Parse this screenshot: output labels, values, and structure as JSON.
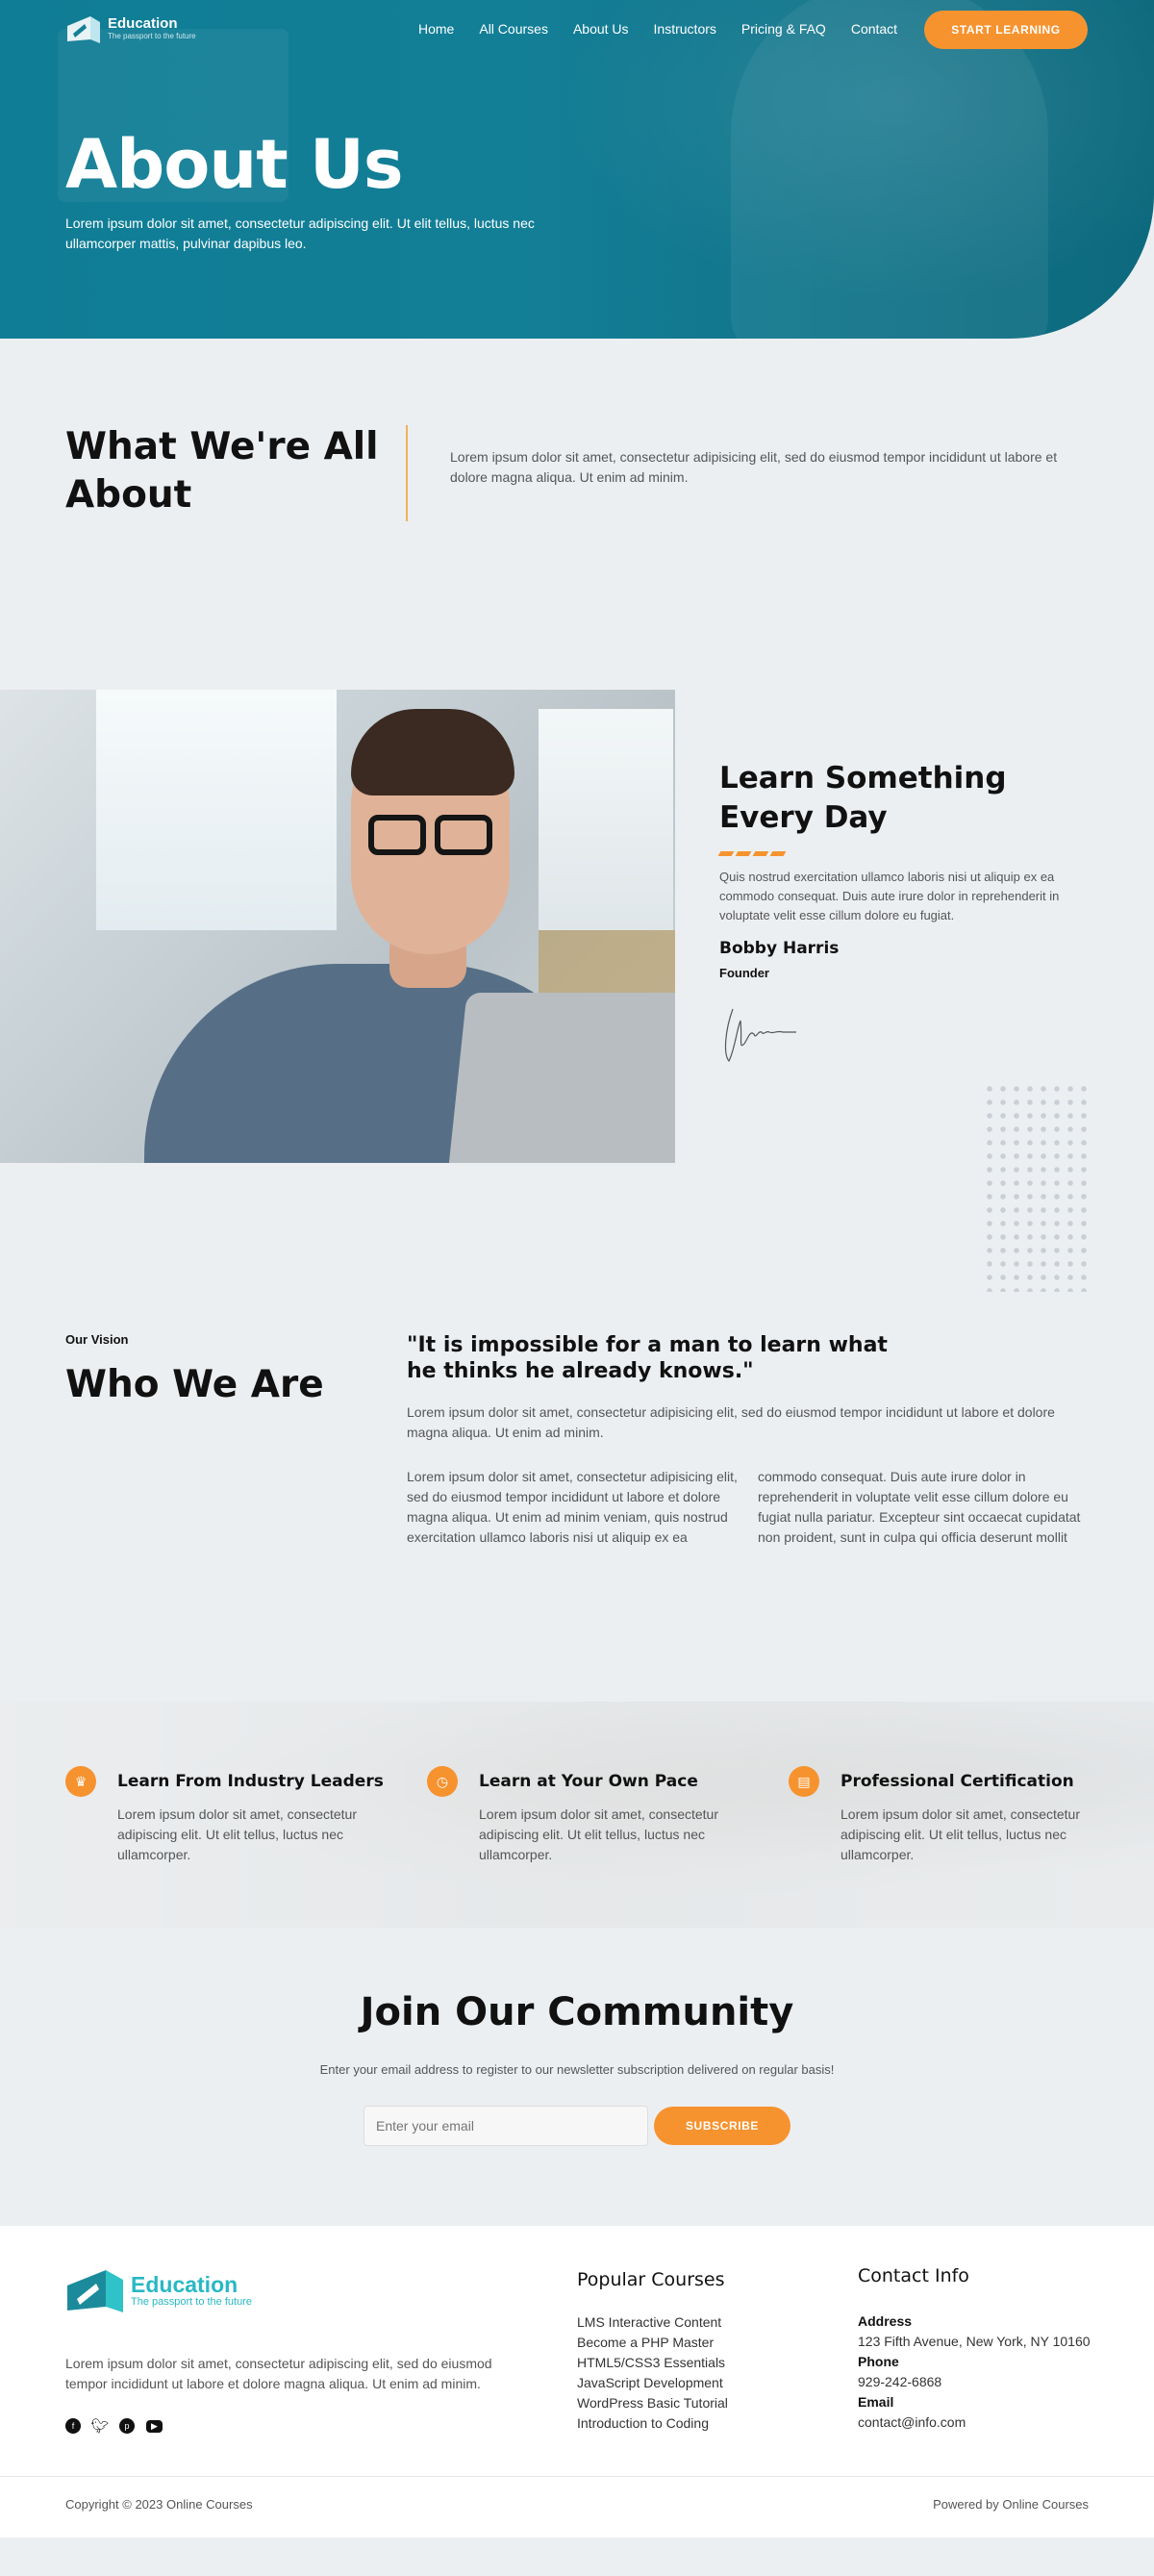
{
  "brand": {
    "name": "Education",
    "tagline": "The passport to the future",
    "accent": "#f6932f",
    "primary": "#127f97"
  },
  "nav": {
    "links": [
      "Home",
      "All Courses",
      "About Us",
      "Instructors",
      "Pricing & FAQ",
      "Contact"
    ],
    "cta": "START LEARNING"
  },
  "hero": {
    "title": "About Us",
    "description": "Lorem ipsum dolor sit amet, consectetur adipiscing elit. Ut elit tellus, luctus nec ullamcorper mattis, pulvinar dapibus leo."
  },
  "about": {
    "title": "What We're All About",
    "text": "Lorem ipsum dolor sit amet, consectetur adipisicing elit, sed do eiusmod tempor incididunt ut labore et dolore magna aliqua. Ut enim ad minim."
  },
  "founder": {
    "title": "Learn Something Every Day",
    "text": "Quis nostrud exercitation ullamco laboris nisi ut aliquip ex ea commodo consequat. Duis aute irure dolor in reprehenderit in voluptate velit esse cillum dolore eu fugiat.",
    "name": "Bobby Harris",
    "role": "Founder"
  },
  "vision": {
    "kicker": "Our Vision",
    "title": "Who We Are",
    "quote": "\"It is impossible for a man to learn what he thinks he already knows.\"",
    "lead": "Lorem ipsum dolor sit amet, consectetur adipisicing elit, sed do eiusmod tempor incididunt ut labore et dolore magna aliqua. Ut enim ad minim.",
    "body": "Lorem ipsum dolor sit amet, consectetur adipisicing elit, sed do eiusmod tempor incididunt ut labore et dolore magna aliqua. Ut enim ad minim veniam, quis nostrud exercitation ullamco laboris nisi ut aliquip ex ea commodo consequat. Duis aute irure dolor in reprehenderit in voluptate velit esse cillum dolore eu fugiat nulla pariatur. Excepteur sint occaecat cupidatat non proident, sunt in culpa qui officia deserunt mollit anim id est laborum. Sed ut perspiciatis unde omnis iste natus error sit voluptatem accusantium doloremque laudantium, totam rem aperiam, eaque ipsa quae ab illo inventore veritatis et quasi architecto beatae vitae dicta sunt explicabo. Nemo enim ipsam voluptatem quia voluptas"
  },
  "features": [
    {
      "icon": "crown-icon",
      "glyph": "♛",
      "title": "Learn From Industry Leaders",
      "text": "Lorem ipsum dolor sit amet, consectetur adipiscing elit. Ut elit tellus, luctus nec ullamcorper."
    },
    {
      "icon": "clock-icon",
      "glyph": "◷",
      "title": "Learn at Your Own Pace",
      "text": "Lorem ipsum dolor sit amet, consectetur adipiscing elit. Ut elit tellus, luctus nec ullamcorper."
    },
    {
      "icon": "certificate-icon",
      "glyph": "▤",
      "title": "Professional Certification",
      "text": "Lorem ipsum dolor sit amet, consectetur adipiscing elit. Ut elit tellus, luctus nec ullamcorper."
    }
  ],
  "community": {
    "title": "Join Our Community",
    "text": "Enter your email address to register to our newsletter subscription delivered on regular basis!",
    "placeholder": "Enter your email",
    "button": "SUBSCRIBE"
  },
  "footer": {
    "about": "Lorem ipsum dolor sit amet, consectetur adipiscing elit, sed do eiusmod tempor incididunt ut labore et dolore magna aliqua. Ut enim ad minim.",
    "courses_title": "Popular Courses",
    "courses": [
      "LMS Interactive Content",
      "Become a PHP Master",
      "HTML5/CSS3 Essentials",
      "JavaScript Development",
      "WordPress Basic Tutorial",
      "Introduction to Coding"
    ],
    "contact_title": "Contact Info",
    "address_label": "Address",
    "address": "123 Fifth Avenue, New York, NY 10160",
    "phone_label": "Phone",
    "phone": "929-242-6868",
    "email_label": "Email",
    "email": "contact@info.com",
    "copyright": "Copyright © 2023 Online Courses",
    "powered": "Powered by Online Courses"
  }
}
